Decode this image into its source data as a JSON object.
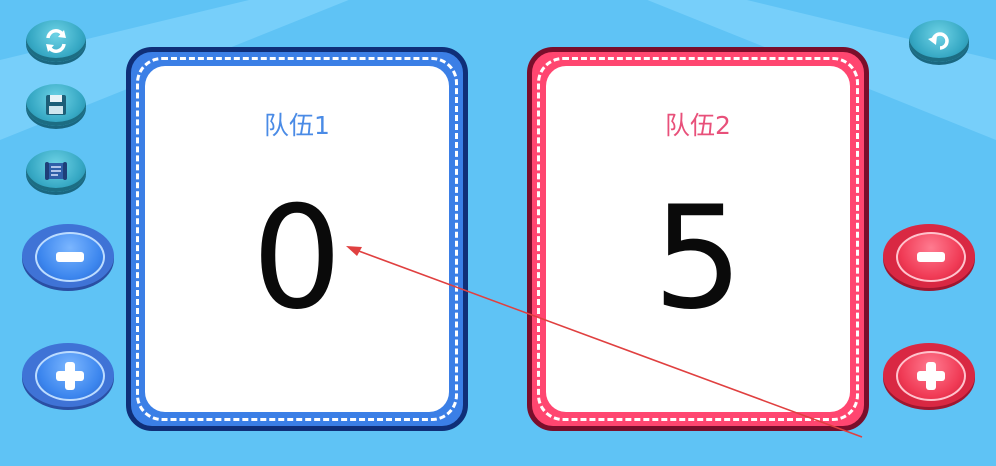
{
  "team1": {
    "name": "队伍1",
    "score": "0",
    "color": "#3b7fe6",
    "title_color": "#4a8be6"
  },
  "team2": {
    "name": "队伍2",
    "score": "5",
    "color": "#ff4670",
    "title_color": "#e8507a"
  },
  "toolbar": {
    "left_icons": [
      "swap-icon",
      "save-icon",
      "scroll-map-icon"
    ],
    "right_icons": [
      "back-arrow-icon"
    ]
  },
  "controls": {
    "team1": [
      "minus-icon",
      "plus-icon"
    ],
    "team2": [
      "minus-icon",
      "plus-icon"
    ]
  },
  "annotation_color": "#e04040"
}
